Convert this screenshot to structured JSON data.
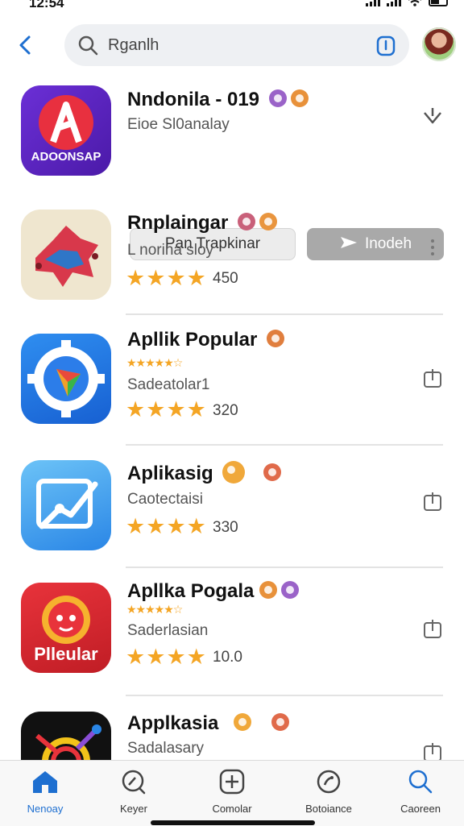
{
  "status": {
    "time": "12:54"
  },
  "search": {
    "query": "Rganlh"
  },
  "featured": {
    "title": "Nndonila - 019",
    "subtitle": "Eioe Sl0analay",
    "icon_label": "ADOONSAP",
    "button_secondary": "Pan Trapkinar",
    "button_primary": "Inodeh",
    "badge_colors": [
      "#9a63c8",
      "#e8913a"
    ]
  },
  "apps": [
    {
      "title": "Rnplaingar",
      "subtitle": "L norina sloy",
      "rating": "450",
      "stars": 4,
      "icon_label": ""
    },
    {
      "title": "Apllik Popular",
      "subtitle": "Sadeatolar1",
      "rating": "320",
      "stars": 4,
      "mini_stars": "★★★★★☆",
      "icon_label": ""
    },
    {
      "title": "Aplikasig",
      "subtitle": "Caotectaisi",
      "rating": "330",
      "stars": 4,
      "icon_label": ""
    },
    {
      "title": "Apllka Pogala",
      "subtitle": "Saderlasian",
      "rating": "10.0",
      "stars": 4,
      "mini_stars": "★★★★★☆",
      "icon_label": "Plleular"
    },
    {
      "title": "Applkasia",
      "subtitle": "Sadalasary",
      "rating": "",
      "stars": 0,
      "icon_label": ""
    }
  ],
  "tabs": [
    {
      "label": "Nenoay",
      "icon": "home-icon",
      "active": true
    },
    {
      "label": "Keyer",
      "icon": "discover-icon",
      "active": false
    },
    {
      "label": "Comolar",
      "icon": "plus-icon",
      "active": false
    },
    {
      "label": "Botoiance",
      "icon": "balance-icon",
      "active": false
    },
    {
      "label": "Caoreen",
      "icon": "search-icon",
      "active": false
    }
  ],
  "colors": {
    "accent": "#1e6fd0",
    "star": "#f4a524"
  }
}
